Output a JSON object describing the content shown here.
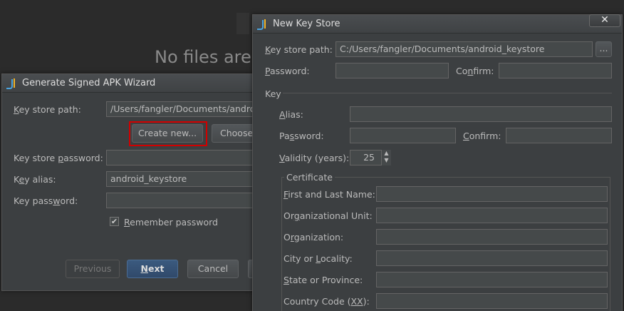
{
  "background": {
    "placeholder_text": "No files are"
  },
  "wizard": {
    "title": "Generate Signed APK Wizard",
    "key_store_path_label_u": "K",
    "key_store_path_label_rest": "ey store path:",
    "key_store_path_value": "/Users/fangler/Documents/android_keystore",
    "create_new_label": "Create new...",
    "choose_label": "Choose existing...",
    "key_store_password_label_pre": "Key store ",
    "key_store_password_label_u": "p",
    "key_store_password_label_rest": "assword:",
    "key_alias_label_pre": "K",
    "key_alias_label_u": "e",
    "key_alias_label_rest": "y alias:",
    "key_alias_value": "android_keystore",
    "key_password_label_pre": "Key pass",
    "key_password_label_u": "w",
    "key_password_label_rest": "ord:",
    "remember_label_u": "R",
    "remember_label_rest": "emember password",
    "remember_checked": "✔",
    "previous_label": "Previous",
    "next_label_u": "N",
    "next_label_rest": "ext",
    "cancel_label": "Cancel"
  },
  "keystore": {
    "title": "New Key Store",
    "close_glyph": "✕",
    "path_label_u": "K",
    "path_label_rest": "ey store path:",
    "path_value": "C:/Users/fangler/Documents/android_keystore",
    "browse_label": "...",
    "password_label_u": "P",
    "password_label_rest": "assword:",
    "confirm_label_pre": "Co",
    "confirm_label_u": "n",
    "confirm_label_rest": "firm:",
    "key_section": "Key",
    "alias_label_u": "A",
    "alias_label_rest": "lias:",
    "key_password_label_pre": "Pa",
    "key_password_label_u": "s",
    "key_password_label_rest": "sword:",
    "key_confirm_label_u": "C",
    "key_confirm_label_rest": "onfirm:",
    "validity_label_u": "V",
    "validity_label_rest": "alidity (years):",
    "validity_value": "25",
    "spinner_up": "▲",
    "spinner_down": "▼",
    "certificate_section": "Certificate",
    "first_last_u": "F",
    "first_last_rest": "irst and Last Name:",
    "org_unit_pre": "Or",
    "org_unit_u": "g",
    "org_unit_rest": "anizational Unit:",
    "org_pre": "O",
    "org_u": "r",
    "org_rest": "ganization:",
    "city_pre": "City or ",
    "city_u": "L",
    "city_rest": "ocality:",
    "state_pre": "",
    "state_u": "S",
    "state_rest": "tate or Province:",
    "country_pre": "Country Code (",
    "country_u": "XX",
    "country_rest": "):"
  }
}
